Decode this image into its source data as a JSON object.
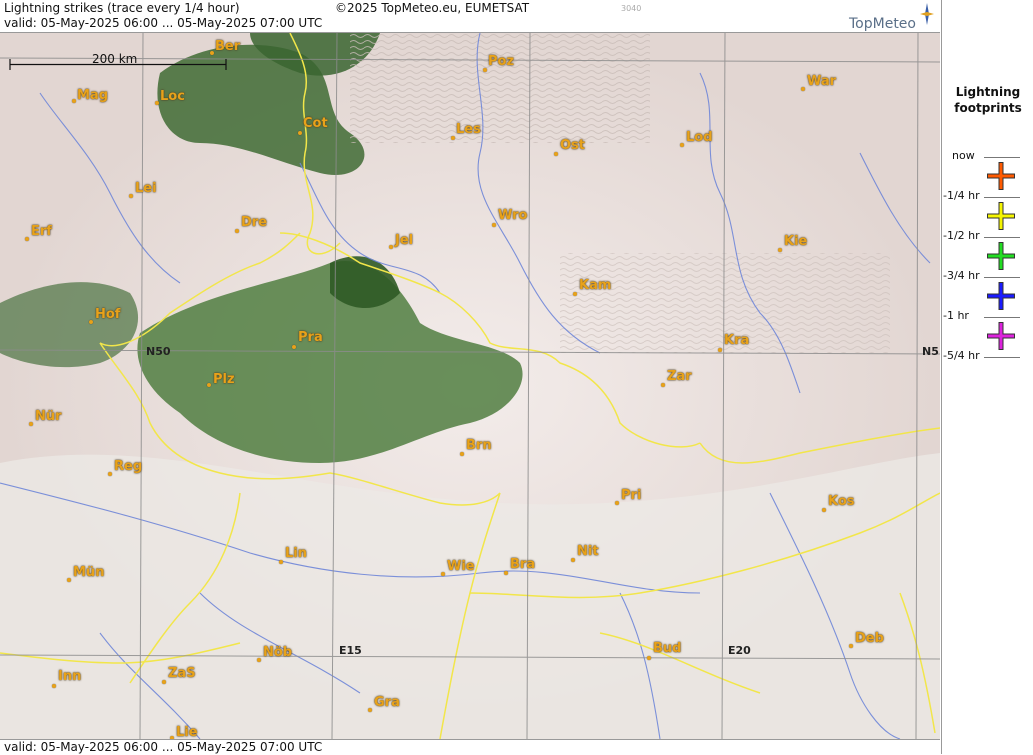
{
  "header": {
    "title": "Lightning strikes (trace every 1/4 hour)",
    "copyright": "©2025 TopMeteo.eu, EUMETSAT",
    "code": "3040",
    "valid": "valid:  05-May-2025 06:00 ... 05-May-2025 07:00 UTC",
    "logo_text": "TopMeteo"
  },
  "footer": {
    "valid": "valid:  05-May-2025 06:00 ... 05-May-2025 07:00 UTC"
  },
  "map": {
    "scale_label": "200 km",
    "coord_labels": [
      "N50",
      "N5",
      "E15",
      "E20"
    ],
    "cities": [
      "Ber",
      "Poz",
      "War",
      "Mag",
      "Loc",
      "Cot",
      "Les",
      "Ost",
      "Lod",
      "Lei",
      "Erf",
      "Dre",
      "Wro",
      "Jel",
      "Kie",
      "Kam",
      "Hof",
      "Pra",
      "Kra",
      "N50",
      "Plz",
      "Zar",
      "Nür",
      "Brn",
      "Reg",
      "Pri",
      "Kos",
      "Lin",
      "Müm",
      "Wie",
      "Bra",
      "Nit",
      "Inn",
      "ZaS",
      "Nöb",
      "Bud",
      "Deb",
      "Gra",
      "Lie"
    ],
    "cities_display": [
      "Ber",
      "Poz",
      "War",
      "Mag",
      "Loc",
      "Cot",
      "Les",
      "Ost",
      "Lod",
      "Lei",
      "Erf",
      "Dre",
      "Wro",
      "Jel",
      "Kie",
      "Kam",
      "Hof",
      "Pra",
      "Kra",
      "Plz",
      "Zar",
      "Nür",
      "Brn",
      "Reg",
      "Pri",
      "Kos",
      "Lin",
      "Mün",
      "Wie",
      "Bra",
      "Nit",
      "Inn",
      "ZaS",
      "Nöb",
      "Bud",
      "Deb",
      "Gra",
      "Lie"
    ],
    "colors": {
      "city_label": "#e8a21a",
      "border": "#f2e64a",
      "river": "#6f86d8",
      "grid": "#8c8c8c",
      "forest": "#3f6b34",
      "cloud": "#ebe0dd"
    }
  },
  "legend": {
    "title_line1": "Lightning",
    "title_line2": "footprints",
    "labels": [
      "now",
      "-1/4 hr",
      "-1/2 hr",
      "-3/4 hr",
      "-1 hr",
      "-5/4 hr"
    ],
    "colors": [
      "#ff5a00",
      "#f5f500",
      "#22dd22",
      "#1a1aff",
      "#dd22dd"
    ]
  }
}
